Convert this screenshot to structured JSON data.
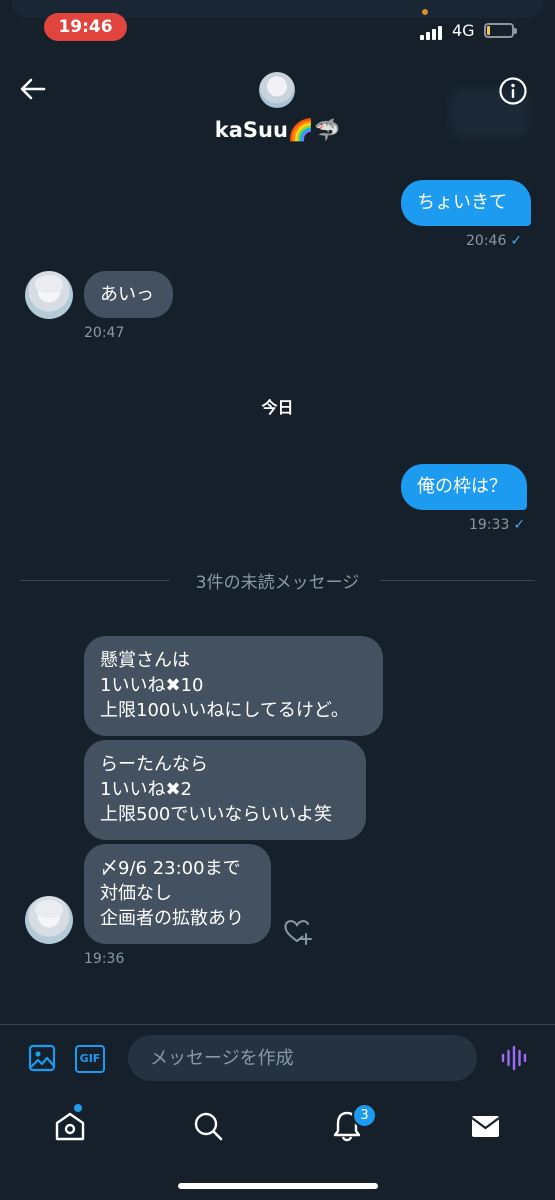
{
  "status_bar": {
    "time": "19:46",
    "network": "4G",
    "battery_level": 0.12
  },
  "header": {
    "contact_name": "kaSuu🌈🦈"
  },
  "messages": [
    {
      "direction": "out",
      "text": "ちょいきて",
      "time": "20:46"
    },
    {
      "direction": "in",
      "text": "あいっ",
      "time": "20:47"
    }
  ],
  "day_label": "今日",
  "messages_today": [
    {
      "direction": "out",
      "text": "俺の枠は？",
      "time": "19:33"
    }
  ],
  "unread_divider": "3件の未読メッセージ",
  "incoming_group": {
    "bubbles": [
      {
        "lines": [
          "懸賞さんは",
          "1いいね✖10",
          "上限100いいねにしてるけど。"
        ]
      },
      {
        "lines": [
          "らーたんなら",
          "1いいね✖2",
          "上限500でいいならいいよ笑"
        ]
      },
      {
        "lines": [
          "〆9/6 23:00まで",
          "対価なし",
          "企画者の拡散あり"
        ]
      }
    ],
    "time": "19:36"
  },
  "composer": {
    "placeholder": "メッセージを作成",
    "gif_label": "GIF"
  },
  "nav": {
    "notifications_badge": "3"
  },
  "colors": {
    "background": "#15202b",
    "accent": "#1d9bf0",
    "incoming_bubble": "#435160",
    "voice": "#9b6cf5"
  }
}
